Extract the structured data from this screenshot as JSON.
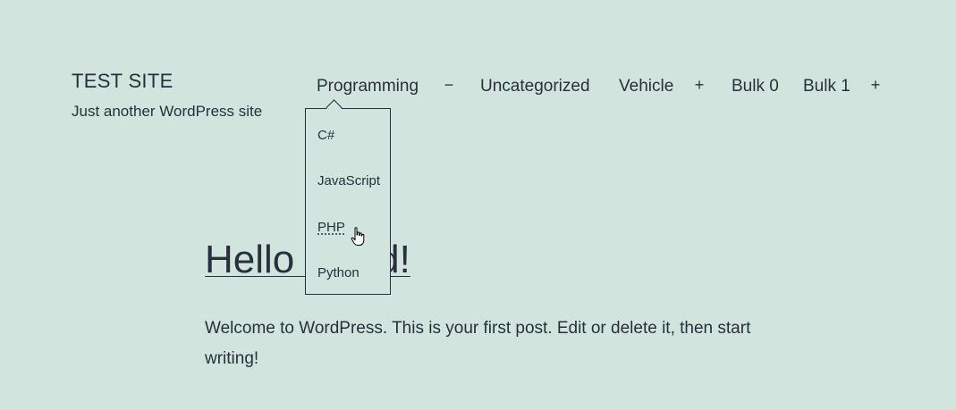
{
  "site": {
    "title": "TEST SITE",
    "description": "Just another WordPress site"
  },
  "nav": {
    "items": [
      {
        "label": "Programming",
        "toggle": "−"
      },
      {
        "label": "Uncategorized"
      },
      {
        "label": "Vehicle",
        "toggle": "+"
      },
      {
        "label": "Bulk 0"
      },
      {
        "label": "Bulk 1",
        "toggle": "+"
      }
    ],
    "submenu": [
      "C#",
      "JavaScript",
      "PHP",
      "Python"
    ]
  },
  "post": {
    "title": "Hello world!",
    "body": "Welcome to WordPress. This is your first post. Edit or delete it, then start writing!"
  },
  "colors": {
    "background": "#d1e4dd",
    "text": "#28303d"
  }
}
